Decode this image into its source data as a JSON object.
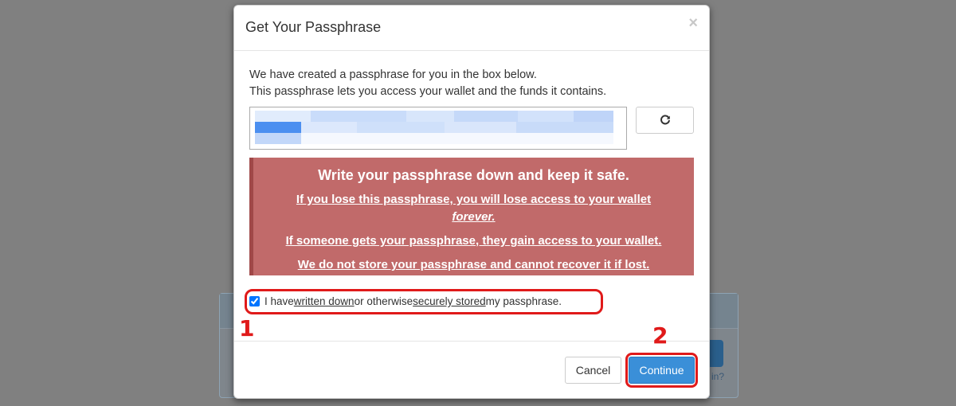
{
  "modal": {
    "title": "Get Your Passphrase",
    "close_label": "×",
    "intro_line1": "We have created a passphrase for you in the box below.",
    "intro_line2": "This passphrase lets you access your wallet and the funds it contains.",
    "refresh_icon": "refresh-icon"
  },
  "warning": {
    "title": "Write your passphrase down and keep it safe.",
    "line1a": "If you lose this passphrase, you will lose access to your wallet",
    "line1b": "forever.",
    "line2": "If someone gets your passphrase, they gain access to your wallet.",
    "line3": "We do not store your passphrase and cannot recover it if lost."
  },
  "confirm": {
    "part1": "I have ",
    "link1": "written down",
    "part2": " or otherwise ",
    "link2": "securely stored",
    "part3": " my passphrase.",
    "checked": true
  },
  "buttons": {
    "cancel": "Cancel",
    "continue": "Continue"
  },
  "annotations": {
    "step1": "1",
    "step2": "2"
  },
  "background": {
    "partial_text": "in?"
  },
  "colors": {
    "warning_bg": "#c16a6a",
    "primary": "#3a8fd8",
    "annotation": "#e01a1a"
  }
}
